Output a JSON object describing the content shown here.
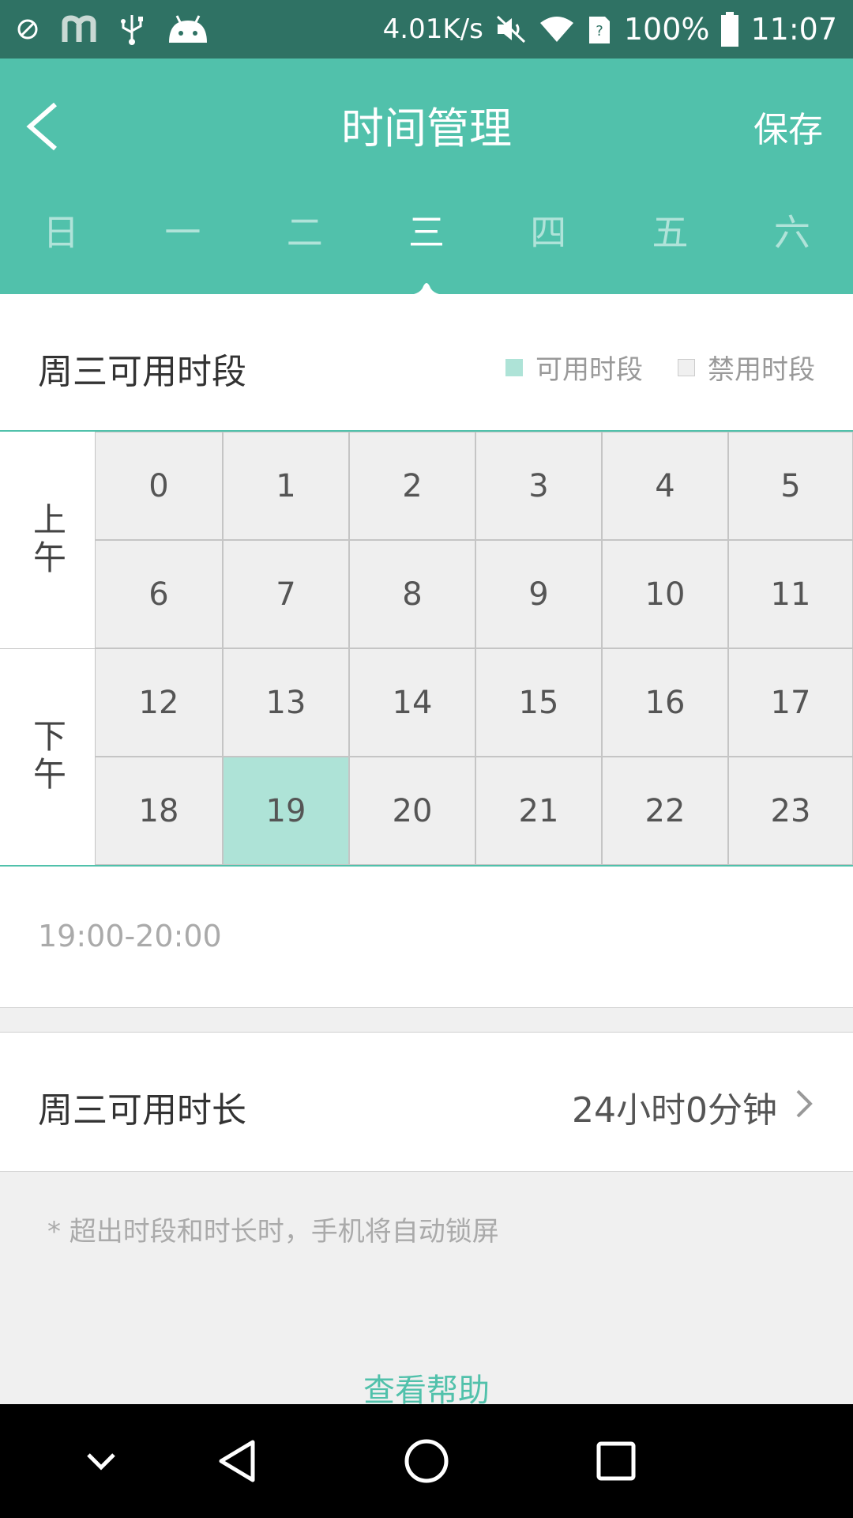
{
  "status_bar": {
    "net_speed": "4.01K/s",
    "battery": "100%",
    "time": "11:07",
    "icons": [
      "block-icon",
      "m-app-icon",
      "usb-icon",
      "android-icon",
      "mute-icon",
      "wifi-icon",
      "sim-unknown-icon",
      "battery-icon"
    ]
  },
  "header": {
    "title": "时间管理",
    "save_label": "保存",
    "back_icon": "chevron-left-icon"
  },
  "week_tabs": {
    "days": [
      "日",
      "一",
      "二",
      "三",
      "四",
      "五",
      "六"
    ],
    "active_index": 3
  },
  "period_section": {
    "title": "周三可用时段",
    "legend_available": "可用时段",
    "legend_blocked": "禁用时段",
    "am_label": "上午",
    "pm_label": "下午",
    "hours": [
      "0",
      "1",
      "2",
      "3",
      "4",
      "5",
      "6",
      "7",
      "8",
      "9",
      "10",
      "11",
      "12",
      "13",
      "14",
      "15",
      "16",
      "17",
      "18",
      "19",
      "20",
      "21",
      "22",
      "23"
    ],
    "selected_hours": [
      "19"
    ],
    "selected_range": "19:00-20:00"
  },
  "duration_section": {
    "label": "周三可用时长",
    "value": "24小时0分钟"
  },
  "note": "* 超出时段和时长时，手机将自动锁屏",
  "help_link": "查看帮助",
  "colors": {
    "accent": "#51c1ab",
    "status_bar": "#2f7264",
    "available": "#aee3d7",
    "blocked": "#efefef"
  }
}
